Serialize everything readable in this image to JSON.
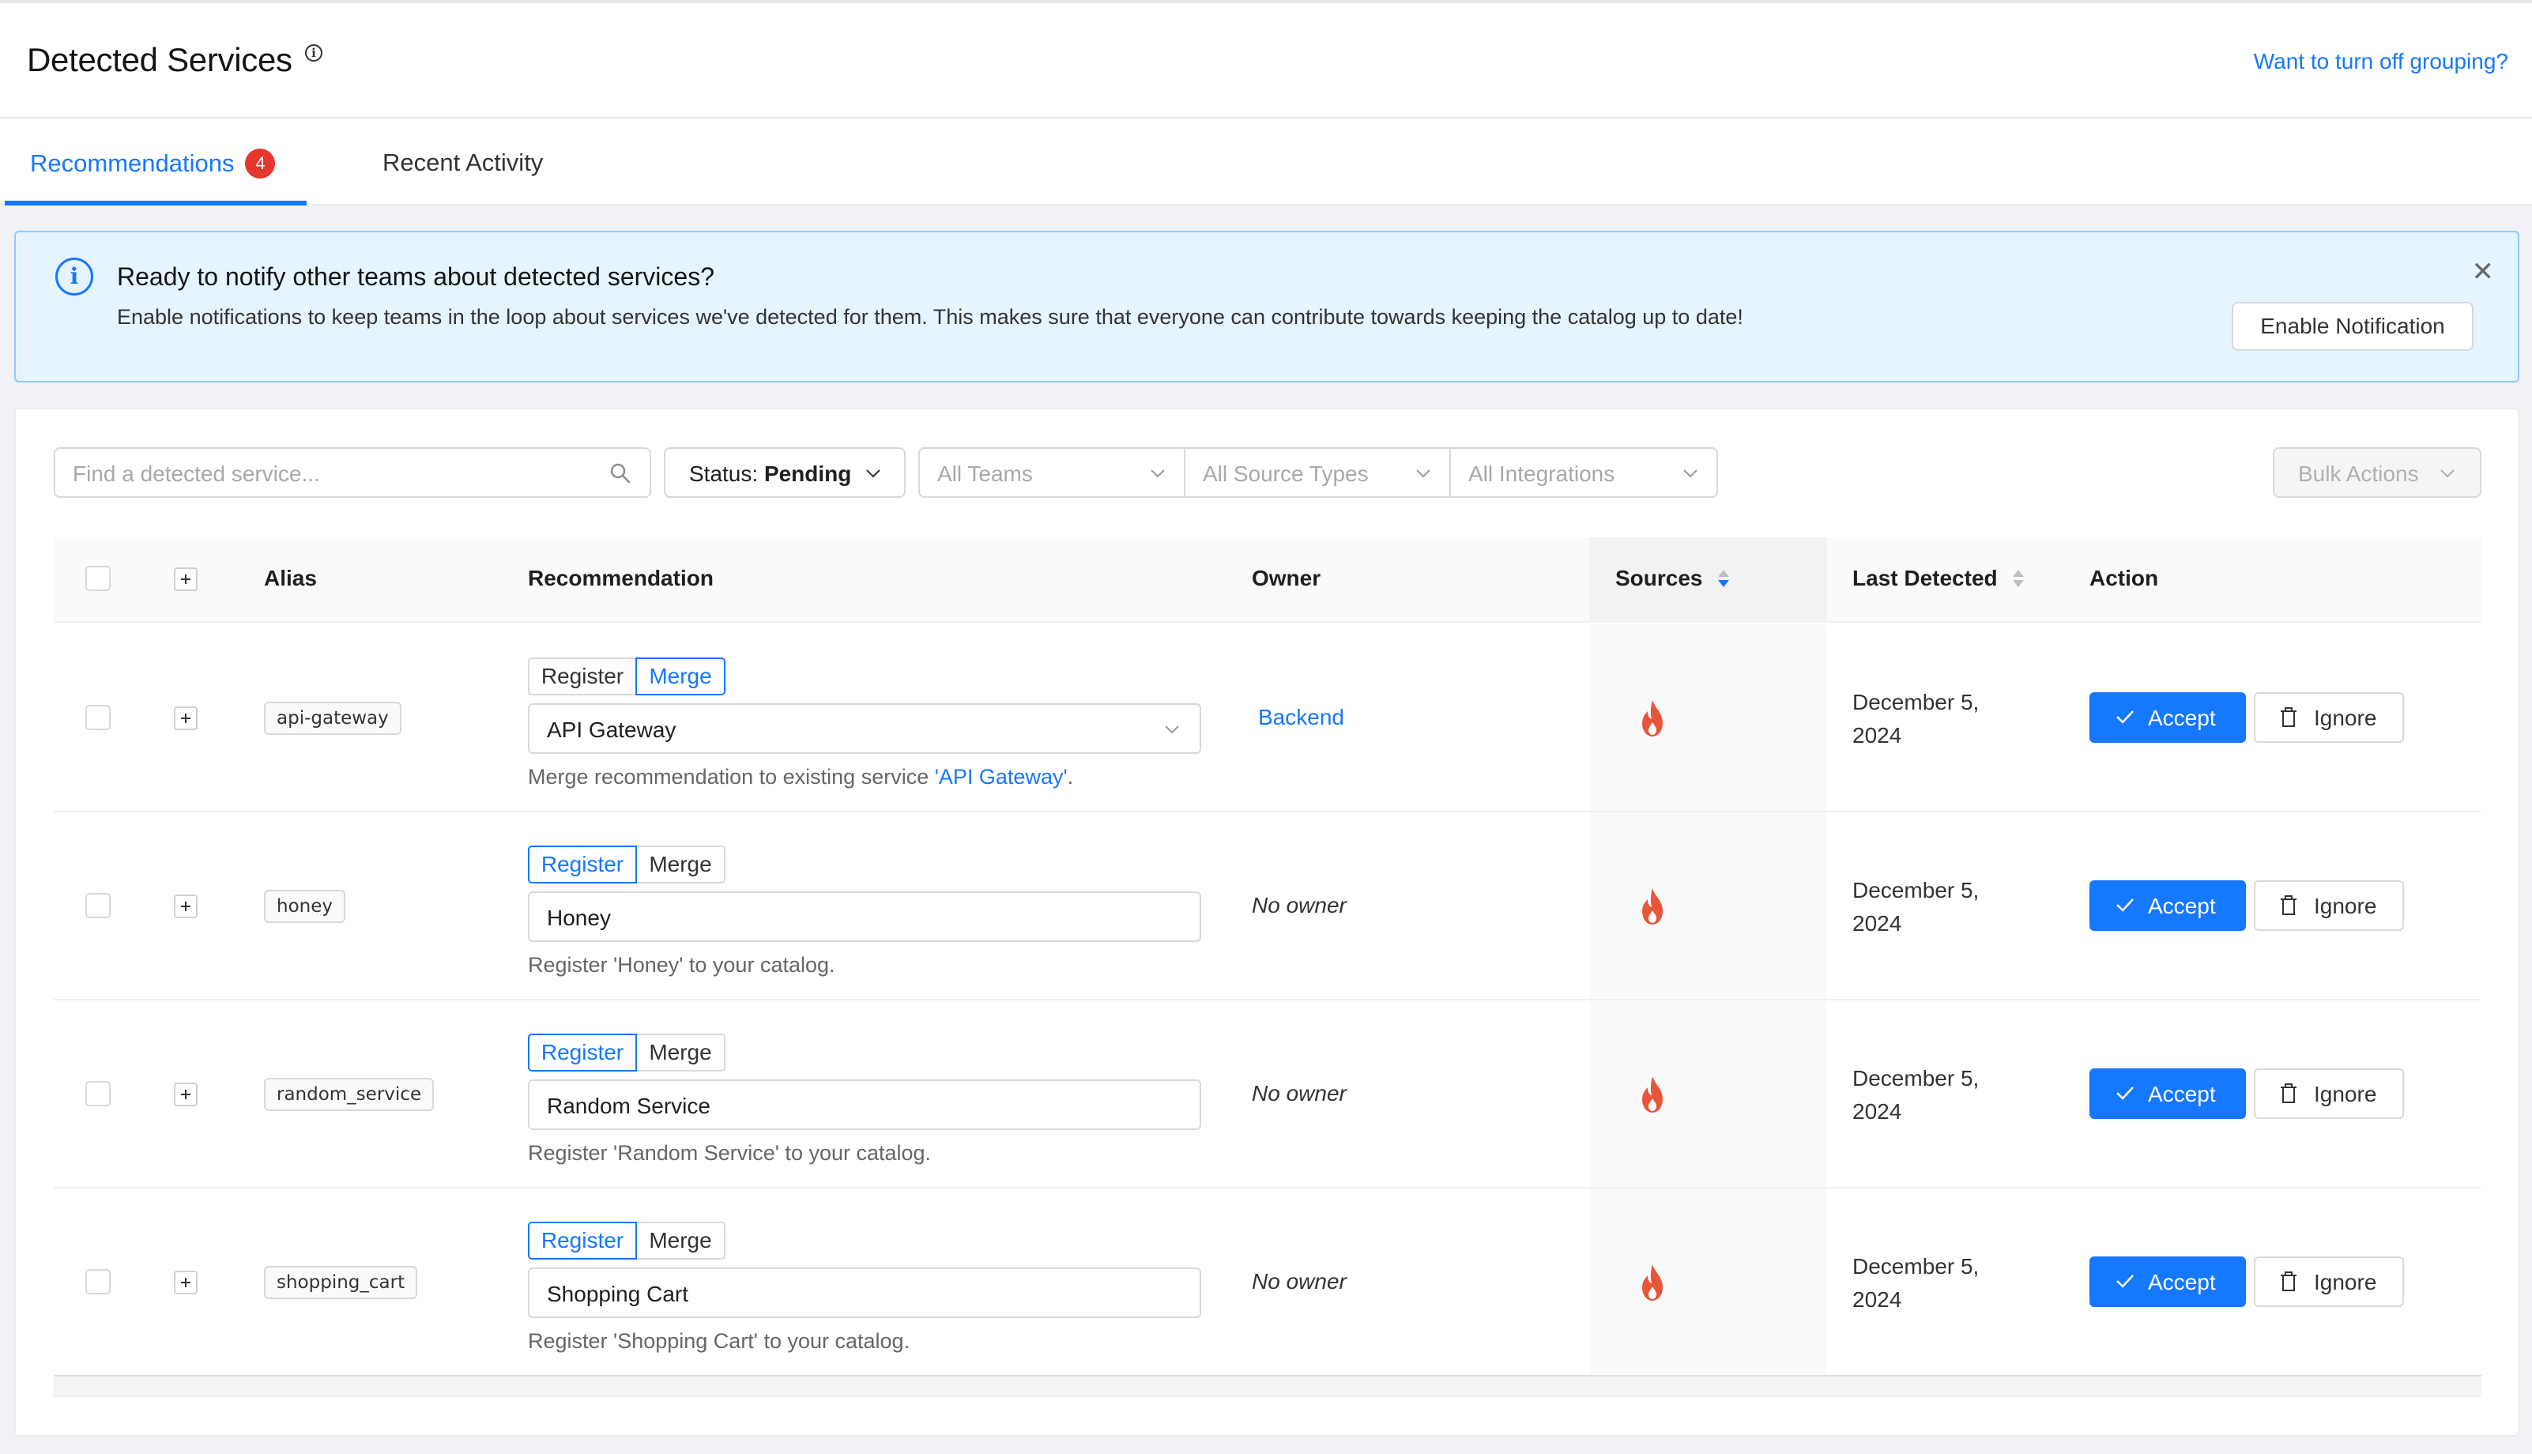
{
  "header": {
    "title": "Detected Services",
    "info_icon": "info-circle-icon",
    "grouping_link": "Want to turn off grouping?"
  },
  "tabs": [
    {
      "label": "Recommendations",
      "badge": "4",
      "active": true
    },
    {
      "label": "Recent Activity",
      "active": false
    }
  ],
  "alert": {
    "icon": "info-icon",
    "title": "Ready to notify other teams about detected services?",
    "description": "Enable notifications to keep teams in the loop about services we've detected for them. This makes sure that everyone can contribute towards keeping the catalog up to date!",
    "button": "Enable Notification",
    "close_icon": "close-icon"
  },
  "filters": {
    "search_placeholder": "Find a detected service...",
    "status_prefix": "Status: ",
    "status_value": "Pending",
    "teams": "All Teams",
    "source_types": "All Source Types",
    "integrations": "All Integrations",
    "bulk_actions": "Bulk Actions"
  },
  "table": {
    "columns": {
      "alias": "Alias",
      "recommendation": "Recommendation",
      "owner": "Owner",
      "sources": "Sources",
      "last_detected": "Last Detected",
      "action": "Action"
    },
    "sort_column": "Sources",
    "segment": {
      "register": "Register",
      "merge": "Merge"
    },
    "accept_label": "Accept",
    "ignore_label": "Ignore",
    "rows": [
      {
        "alias": "api-gateway",
        "mode": "Merge",
        "service": "API Gateway",
        "note_pre": "Merge recommendation to existing service ",
        "note_link": "'API Gateway'",
        "note_post": ".",
        "owner": "Backend",
        "owner_is_link": true,
        "source_icon": "fire-icon",
        "last_detected": "December 5, 2024"
      },
      {
        "alias": "honey",
        "mode": "Register",
        "service": "Honey",
        "note_pre": "Register 'Honey' to your catalog.",
        "owner": "No owner",
        "owner_is_link": false,
        "source_icon": "fire-icon",
        "last_detected": "December 5, 2024"
      },
      {
        "alias": "random_service",
        "mode": "Register",
        "service": "Random Service",
        "note_pre": "Register 'Random Service' to your catalog.",
        "owner": "No owner",
        "owner_is_link": false,
        "source_icon": "fire-icon",
        "last_detected": "December 5, 2024"
      },
      {
        "alias": "shopping_cart",
        "mode": "Register",
        "service": "Shopping Cart",
        "note_pre": "Register 'Shopping Cart' to your catalog.",
        "owner": "No owner",
        "owner_is_link": false,
        "source_icon": "fire-icon",
        "last_detected": "December 5, 2024"
      }
    ]
  },
  "colors": {
    "primary": "#1677ff",
    "badge": "#e5362d",
    "fire": "#e8553a",
    "alert_bg": "#e6f4ff"
  }
}
